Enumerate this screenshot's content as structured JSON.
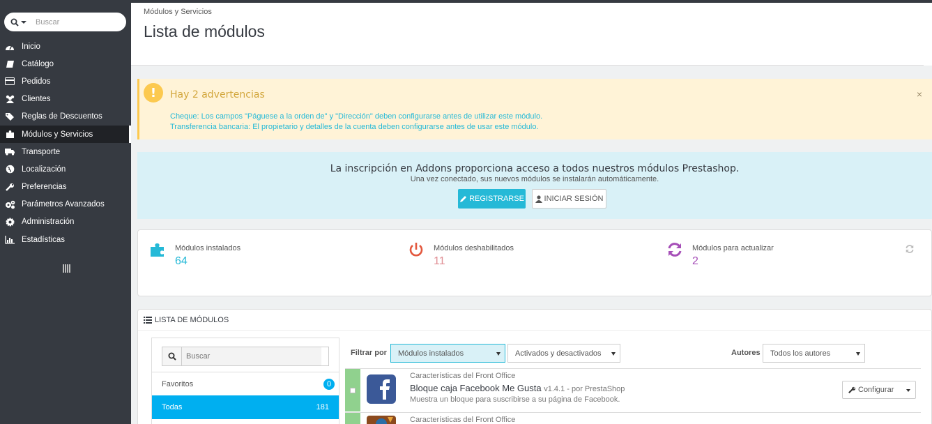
{
  "sidebar": {
    "search_placeholder": "Buscar",
    "items": [
      {
        "label": "Inicio",
        "icon": "tachometer-icon"
      },
      {
        "label": "Catálogo",
        "icon": "book-icon"
      },
      {
        "label": "Pedidos",
        "icon": "credit-card-icon"
      },
      {
        "label": "Clientes",
        "icon": "users-icon"
      },
      {
        "label": "Reglas de Descuentos",
        "icon": "tags-icon"
      },
      {
        "label": "Módulos y Servicios",
        "icon": "puzzle-piece-icon",
        "active": true
      },
      {
        "label": "Transporte",
        "icon": "truck-icon"
      },
      {
        "label": "Localización",
        "icon": "globe-icon"
      },
      {
        "label": "Preferencias",
        "icon": "wrench-icon"
      },
      {
        "label": "Parámetros Avanzados",
        "icon": "cogs-icon"
      },
      {
        "label": "Administración",
        "icon": "cog-icon"
      },
      {
        "label": "Estadísticas",
        "icon": "bar-chart-icon"
      }
    ]
  },
  "header": {
    "breadcrumb": "Módulos y Servicios",
    "title": "Lista de módulos"
  },
  "warning": {
    "title": "Hay 2 advertencias",
    "lines": [
      "Cheque: Los campos \"Páguese a la orden de\" y \"Dirección\" deben configurarse antes de utilizar este módulo.",
      "Transferencia bancaria: El propietario y detalles de la cuenta deben configurarse antes de usar este módulo."
    ],
    "close": "×"
  },
  "addons": {
    "headline": "La inscripción en Addons proporciona acceso a todos nuestros módulos Prestashop.",
    "subline": "Una vez conectado, sus nuevos módulos se instalarán automáticamente.",
    "register_label": "REGISTRARSE",
    "login_label": "INICIAR SESIÓN"
  },
  "stats": [
    {
      "label": "Módulos instalados",
      "value": "64",
      "color": "#25b9d7"
    },
    {
      "label": "Módulos deshabilitados",
      "value": "11",
      "color": "#e08f95"
    },
    {
      "label": "Módulos para actualizar",
      "value": "2",
      "color": "#a64fb8"
    }
  ],
  "module_list": {
    "heading": "LISTA DE MÓDULOS",
    "search_placeholder": "Buscar",
    "favorites_label": "Favoritos",
    "favorites_count": "0",
    "all_label": "Todas",
    "all_count": "181",
    "filter_label": "Filtrar por",
    "filter_installed": "Módulos instalados",
    "filter_status": "Activados y desactivados",
    "authors_label": "Autores",
    "authors_value": "Todos los autores",
    "modules": [
      {
        "category": "Características del Front Office",
        "name": "Bloque caja Facebook Me Gusta",
        "version": "v1.4.1 - por PrestaShop",
        "description": "Muestra un bloque para suscribirse a su página de Facebook.",
        "action": "Configurar"
      },
      {
        "category": "Características del Front Office"
      }
    ]
  }
}
